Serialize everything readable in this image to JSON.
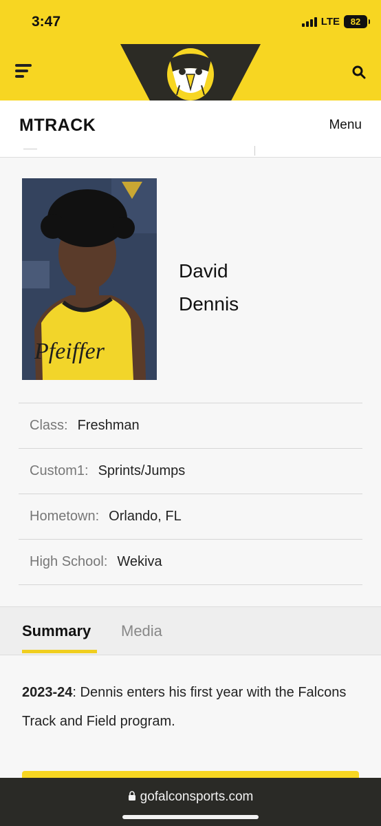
{
  "status": {
    "time": "3:47",
    "network": "LTE",
    "battery": "82"
  },
  "header": {
    "logo_icon": "falcon-head-icon",
    "menu_icon": "hamburger-icon",
    "search_icon": "search-icon",
    "brand_color": "#f7d622"
  },
  "subnav": {
    "title": "MTRACK",
    "menu_label": "Menu"
  },
  "profile": {
    "first_name": "David",
    "last_name": "Dennis",
    "photo_icon": "athlete-photo"
  },
  "info": [
    {
      "label": "Class:",
      "value": "Freshman"
    },
    {
      "label": "Custom1:",
      "value": "Sprints/Jumps"
    },
    {
      "label": "Hometown:",
      "value": "Orlando, FL"
    },
    {
      "label": "High School:",
      "value": "Wekiva"
    }
  ],
  "tabs": [
    {
      "label": "Summary",
      "active": true
    },
    {
      "label": "Media",
      "active": false
    }
  ],
  "summary": {
    "year": "2023-24",
    "text": ": Dennis enters his first year with the Falcons Track and Field program."
  },
  "browser": {
    "url": "gofalconsports.com"
  }
}
